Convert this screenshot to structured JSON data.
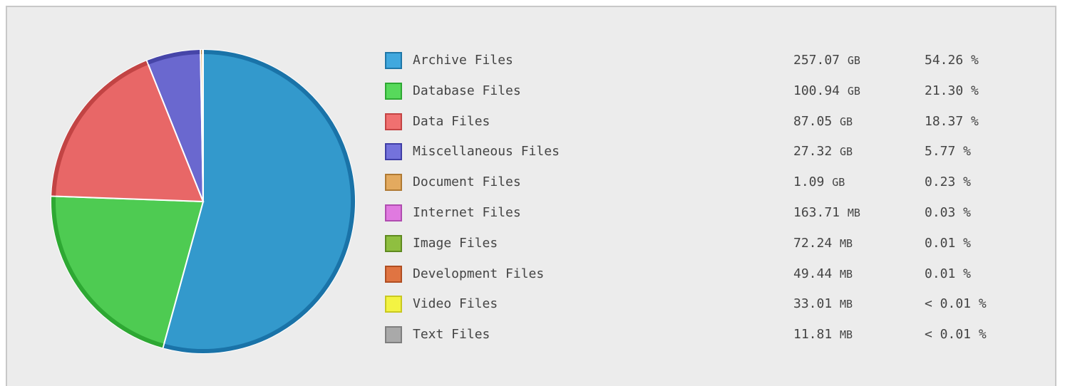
{
  "chart_data": {
    "type": "pie",
    "legend_position": "right",
    "series": [
      {
        "name": "Archive Files",
        "size_value": "257.07",
        "size_unit": "GB",
        "percent_label": "54.26 %",
        "percent": 54.26,
        "color": "#3399cc",
        "border": "#1a73a8",
        "swatch": "#40a8de",
        "swatch_border": "#1f77a8"
      },
      {
        "name": "Database Files",
        "size_value": "100.94",
        "size_unit": "GB",
        "percent_label": "21.30 %",
        "percent": 21.3,
        "color": "#4ecb52",
        "border": "#2ea833",
        "swatch": "#57d95b",
        "swatch_border": "#2ea833"
      },
      {
        "name": "Data Files",
        "size_value": "87.05",
        "size_unit": "GB",
        "percent_label": "18.37 %",
        "percent": 18.37,
        "color": "#e86767",
        "border": "#c24444",
        "swatch": "#f07070",
        "swatch_border": "#c44444"
      },
      {
        "name": "Miscellaneous Files",
        "size_value": "27.32",
        "size_unit": "GB",
        "percent_label": "5.77 %",
        "percent": 5.77,
        "color": "#6a68cf",
        "border": "#4645a8",
        "swatch": "#7472dc",
        "swatch_border": "#3f3ea6"
      },
      {
        "name": "Document Files",
        "size_value": "1.09",
        "size_unit": "GB",
        "percent_label": "0.23 %",
        "percent": 0.23,
        "color": "#d9a255",
        "border": "#b27a33",
        "swatch": "#e3aa5f",
        "swatch_border": "#b07a33"
      },
      {
        "name": "Internet Files",
        "size_value": "163.71",
        "size_unit": "MB",
        "percent_label": "0.03 %",
        "percent": 0.03,
        "color": "#da70da",
        "border": "#b04db0",
        "swatch": "#e07ae0",
        "swatch_border": "#b04db0"
      },
      {
        "name": "Image Files",
        "size_value": "72.24",
        "size_unit": "MB",
        "percent_label": "0.01 %",
        "percent": 0.01,
        "color": "#8fbc3f",
        "border": "#6a9422",
        "swatch": "#8fbf40",
        "swatch_border": "#5f8a20"
      },
      {
        "name": "Development Files",
        "size_value": "49.44",
        "size_unit": "MB",
        "percent_label": "0.01 %",
        "percent": 0.01,
        "color": "#dc7040",
        "border": "#b04e22",
        "swatch": "#e07442",
        "swatch_border": "#b04e22"
      },
      {
        "name": "Video Files",
        "size_value": "33.01",
        "size_unit": "MB",
        "percent_label": "< 0.01 %",
        "percent": 0.004,
        "color": "#f0f040",
        "border": "#c9c922",
        "swatch": "#f3f343",
        "swatch_border": "#c9c922"
      },
      {
        "name": "Text Files",
        "size_value": "11.81",
        "size_unit": "MB",
        "percent_label": "< 0.01 %",
        "percent": 0.001,
        "color": "#a8a8a8",
        "border": "#7f7f7f",
        "swatch": "#a9a9a9",
        "swatch_border": "#7f7f7f"
      }
    ]
  }
}
